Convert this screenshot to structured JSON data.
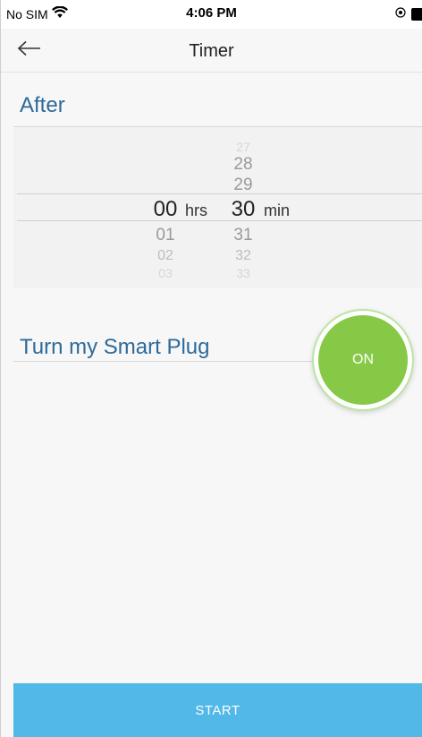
{
  "status_bar": {
    "carrier": "No SIM",
    "wifi_icon": "wifi-icon",
    "time": "4:06 PM",
    "orientation_icon": "orientation-lock-icon",
    "battery_icon": "battery-icon"
  },
  "nav": {
    "back_icon": "arrow-left-icon",
    "title": "Timer"
  },
  "after_section": {
    "title": "After",
    "hours": {
      "above": [
        "",
        "",
        ""
      ],
      "selected": "00",
      "below": [
        "01",
        "02",
        "03"
      ],
      "unit": "hrs"
    },
    "minutes": {
      "above": [
        "27",
        "28",
        "29"
      ],
      "selected": "30",
      "below": [
        "31",
        "32",
        "33"
      ],
      "unit": "min"
    }
  },
  "plug_section": {
    "title": "Turn my Smart Plug",
    "toggle_label": "ON",
    "toggle_color": "#86c946"
  },
  "start_button": {
    "label": "START",
    "color": "#51b8e8"
  },
  "colors": {
    "section_title": "#2d6a9a",
    "background": "#f7f7f7"
  }
}
